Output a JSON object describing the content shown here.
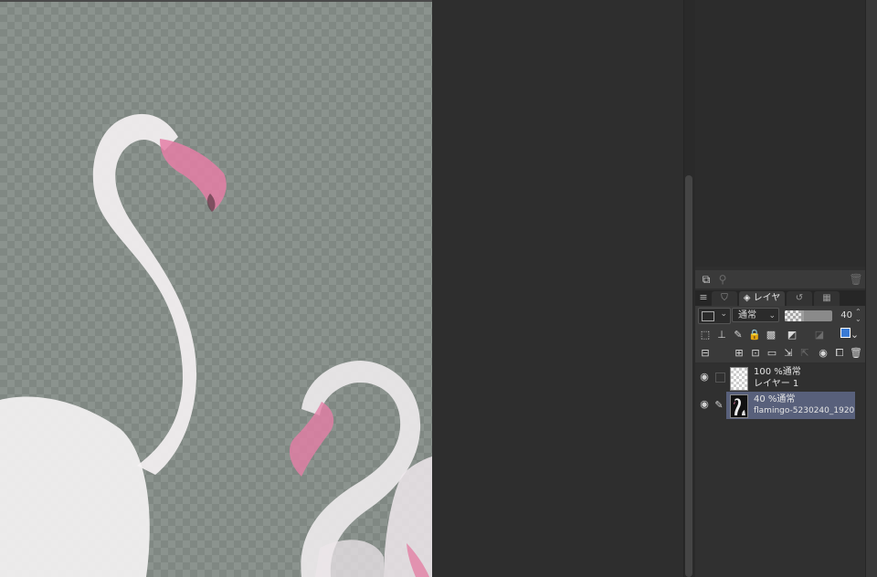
{
  "app": {
    "canvas_description_icon": "flamingo-photo"
  },
  "layer_panel": {
    "tabs": [
      {
        "icon": "layer-property-icon",
        "label": ""
      },
      {
        "icon": "layer-stack-icon",
        "label": "レイヤー"
      },
      {
        "icon": "undo-history-icon",
        "label": ""
      },
      {
        "icon": "animation-icon",
        "label": ""
      }
    ],
    "blend_mode": "通常",
    "opacity_value": "40",
    "opacity_fraction": 0.4,
    "layers": [
      {
        "opacity_mode": "100 %通常",
        "name": "レイヤー 1",
        "visible": true,
        "selected": false,
        "thumbnail": "transparent"
      },
      {
        "opacity_mode": "40 %通常",
        "name": "flamingo-5230240_1920",
        "visible": true,
        "selected": true,
        "thumbnail": "flamingo"
      }
    ]
  },
  "colors": {
    "selection": "#58607b",
    "panel_bg": "#2f2f2f",
    "canvas_tint": "#4d5a51",
    "beak_pink": "#e57ea6"
  }
}
